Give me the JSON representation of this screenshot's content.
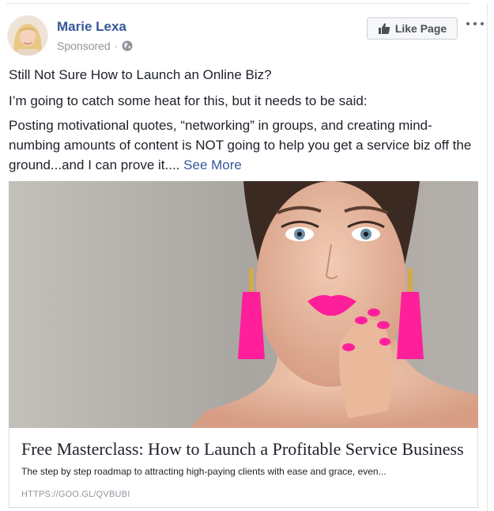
{
  "post": {
    "author": "Marie Lexa",
    "sponsored": "Sponsored",
    "separator": "·",
    "like_page_label": "Like Page",
    "lines": {
      "headline": "Still Not Sure How to Launch an Online Biz?",
      "line2": "I’m going to catch some heat for this, but it needs to be said:",
      "line3": "Posting motivational quotes, “networking” in groups, and creating mind-numbing amounts of content is NOT going to help you get a service biz off the ground...and I can prove it....",
      "see_more": "See More"
    },
    "link": {
      "title": "Free Masterclass: How to Launch a Profitable Service Business",
      "description": "The step by step roadmap to attracting high-paying clients with ease and grace, even...",
      "url": "HTTPS://GOO.GL/QVBUBI"
    }
  },
  "colors": {
    "brand_link": "#365899",
    "muted": "#90949c",
    "accent_pink": "#ff1f9a"
  },
  "icons": [
    "globe-icon",
    "thumbs-up-icon",
    "more-options-icon"
  ]
}
